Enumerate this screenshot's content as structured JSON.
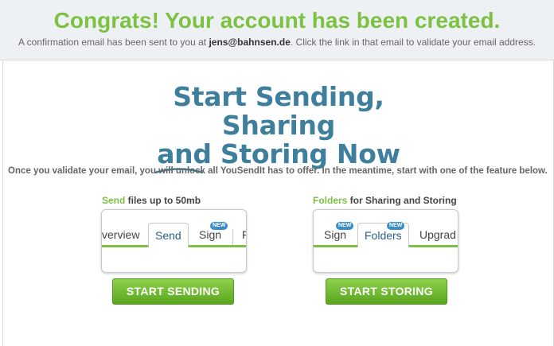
{
  "header": {
    "title": "Congrats! Your account has been created.",
    "confirm_prefix": "A confirmation email has been sent to you at ",
    "email": "jens@bahnsen.de",
    "confirm_suffix": ". Click the link in that email to validate your email address."
  },
  "hero": {
    "line1": "Start Sending, Sharing",
    "line2_word": "and",
    "line2_rest": " Storing Now"
  },
  "intro": "Once you validate your email, you will unlock all YouSendIt has to offer. In the meantime, start with one of the feature below.",
  "send_feature": {
    "title_highlight": "Send",
    "title_rest": " files up to 50mb",
    "tabs": [
      "verview",
      "Send",
      "Sign",
      "F"
    ],
    "badge": "NEW",
    "button": "START SENDING"
  },
  "store_feature": {
    "title_highlight": "Folders",
    "title_rest": " for Sharing and Storing",
    "tabs": [
      "Sign",
      "Folders",
      "Upgrad"
    ],
    "badge": "NEW",
    "button": "START STORING"
  },
  "colors": {
    "accent_green": "#7cc142",
    "hero_blue": "#3f7f9e",
    "tab_active": "#2c5f8a",
    "badge_blue": "#3a8ec8"
  }
}
